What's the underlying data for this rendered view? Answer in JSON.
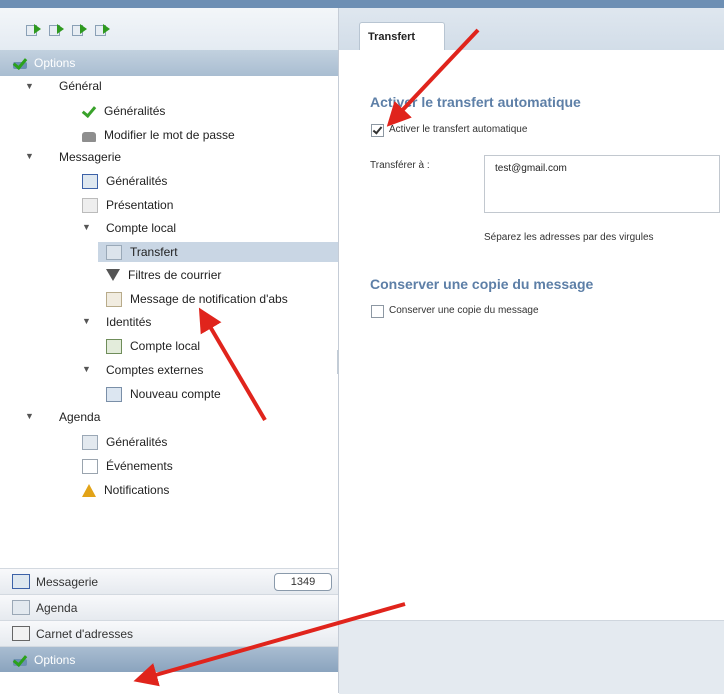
{
  "left": {
    "section_title": "Options",
    "tree": [
      {
        "label": "Général",
        "icon": "expand-arrow"
      },
      {
        "label": "Généralités",
        "icon": "check-icon"
      },
      {
        "label": "Modifier le mot de passe",
        "icon": "lock-icon"
      },
      {
        "label": "Messagerie",
        "icon": "expand-arrow"
      },
      {
        "label": "Généralités",
        "icon": "mail-settings-icon"
      },
      {
        "label": "Présentation",
        "icon": "page-icon"
      },
      {
        "label": "Compte local",
        "icon": "expand-arrow"
      },
      {
        "label": "Transfert",
        "icon": "forward-icon"
      },
      {
        "label": "Filtres de courrier",
        "icon": "filter-icon"
      },
      {
        "label": "Message de notification d'abs",
        "icon": "note-icon"
      },
      {
        "label": "Identités",
        "icon": "expand-arrow"
      },
      {
        "label": "Compte local",
        "icon": "identity-icon"
      },
      {
        "label": "Comptes externes",
        "icon": "expand-arrow"
      },
      {
        "label": "Nouveau compte",
        "icon": "new-account-icon"
      },
      {
        "label": "Agenda",
        "icon": "expand-arrow"
      },
      {
        "label": "Généralités",
        "icon": "calendar-icon"
      },
      {
        "label": "Événements",
        "icon": "events-icon"
      },
      {
        "label": "Notifications",
        "icon": "bell-icon"
      }
    ],
    "bottom_nav": [
      {
        "label": "Messagerie",
        "badge": "1349"
      },
      {
        "label": "Agenda"
      },
      {
        "label": "Carnet d'adresses"
      },
      {
        "label": "Options"
      }
    ]
  },
  "right": {
    "tab": "Transfert",
    "section1_title": "Activer le transfert automatique",
    "enable_forward_label": "Activer le transfert automatique",
    "enable_forward_checked": true,
    "forward_to_label": "Transférer à :",
    "forward_to_value": "test@gmail.com",
    "hint": "Séparez les adresses par des virgules",
    "section2_title": "Conserver une copie du message",
    "keep_copy_label": "Conserver une copie du message",
    "keep_copy_checked": false
  },
  "colors": {
    "accent": "#5d7fa7",
    "selection": "#c9d6e4",
    "arrow": "#e0241c"
  }
}
